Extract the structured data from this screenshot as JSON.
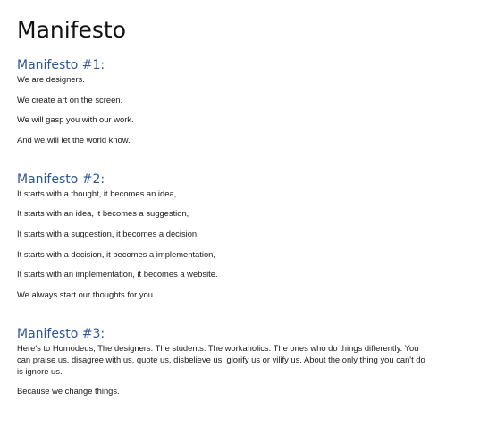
{
  "document": {
    "title": "Manifesto",
    "sections": [
      {
        "heading": "Manifesto #1:",
        "paragraphs": [
          "We are designers.",
          "We create art on the screen.",
          "We will gasp you with our work.",
          "And we will let the world know."
        ]
      },
      {
        "heading": "Manifesto #2:",
        "paragraphs": [
          "It starts with a thought, it becomes an idea,",
          "It starts with an idea, it becomes a suggestion,",
          "It starts with a suggestion, it becomes a decision,",
          "It starts with a decision, it becomes a implementation,",
          "It starts with an implementation, it becomes a website.",
          "We always start our thoughts for you."
        ]
      },
      {
        "heading": "Manifesto #3:",
        "paragraphs": [
          "Here's to Homodeus, The designers. The students. The workaholics. The ones who do things differently. You can praise us, disagree with us, quote us, disbelieve us, glorify us or vilify us. About the only thing you can't do is ignore us.",
          "Because we change things."
        ]
      }
    ]
  },
  "colors": {
    "heading": "#2e5595",
    "text": "#1a1a1a"
  }
}
